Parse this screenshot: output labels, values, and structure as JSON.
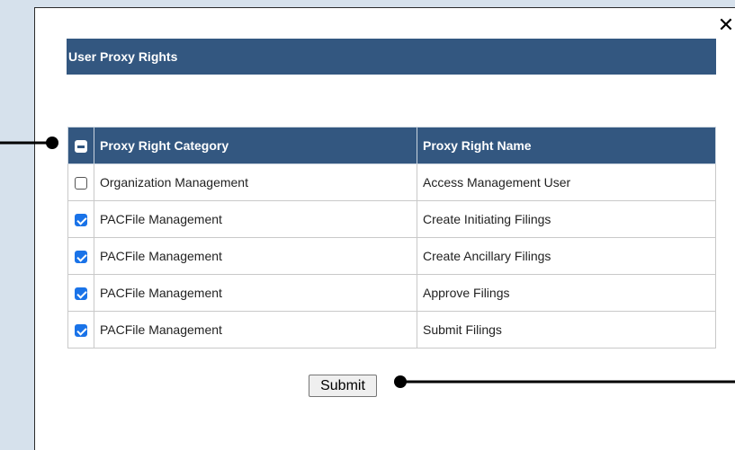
{
  "dialog": {
    "close_glyph": "✕",
    "title": "User Proxy Rights"
  },
  "table": {
    "headers": {
      "select_all_state": "indeterminate",
      "category": "Proxy Right Category",
      "name": "Proxy Right Name"
    },
    "rows": [
      {
        "checked": false,
        "category": "Organization Management",
        "name": "Access Management User"
      },
      {
        "checked": true,
        "category": "PACFile Management",
        "name": "Create Initiating Filings"
      },
      {
        "checked": true,
        "category": "PACFile Management",
        "name": "Create Ancillary Filings"
      },
      {
        "checked": true,
        "category": "PACFile Management",
        "name": "Approve Filings"
      },
      {
        "checked": true,
        "category": "PACFile Management",
        "name": "Submit Filings"
      }
    ]
  },
  "actions": {
    "submit_label": "Submit"
  },
  "colors": {
    "header_bg": "#335780",
    "page_bg": "#d6e1ec",
    "checkbox_accent": "#1a73e8"
  }
}
